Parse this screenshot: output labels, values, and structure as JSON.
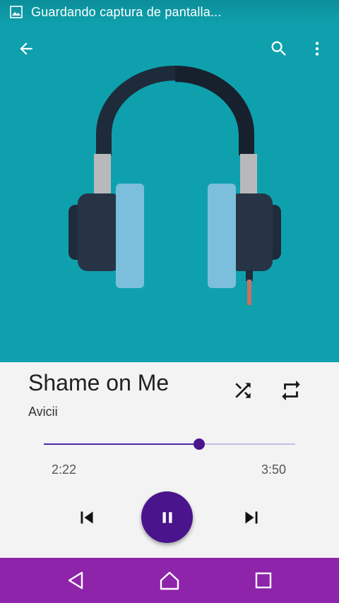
{
  "status_bar": {
    "notification_text": "Guardando captura de pantalla...",
    "icon": "image-icon"
  },
  "toolbar": {
    "back_icon": "arrow-back-icon",
    "search_icon": "search-icon",
    "more_icon": "more-vert-icon"
  },
  "artwork": {
    "icon": "headphones-icon",
    "background_color": "#0fa0ad"
  },
  "track": {
    "title": "Shame on Me",
    "artist": "Avicii"
  },
  "progress": {
    "elapsed": "2:22",
    "total": "3:50",
    "fraction": 0.617
  },
  "controls": {
    "shuffle_icon": "shuffle-icon",
    "repeat_icon": "repeat-icon",
    "previous_icon": "skip-previous-icon",
    "play_pause_icon": "pause-icon",
    "next_icon": "skip-next-icon",
    "accent_color": "#4a148c"
  },
  "nav_bar": {
    "back_icon": "nav-back-icon",
    "home_icon": "nav-home-icon",
    "recents_icon": "nav-recents-icon",
    "color": "#8e24aa"
  }
}
